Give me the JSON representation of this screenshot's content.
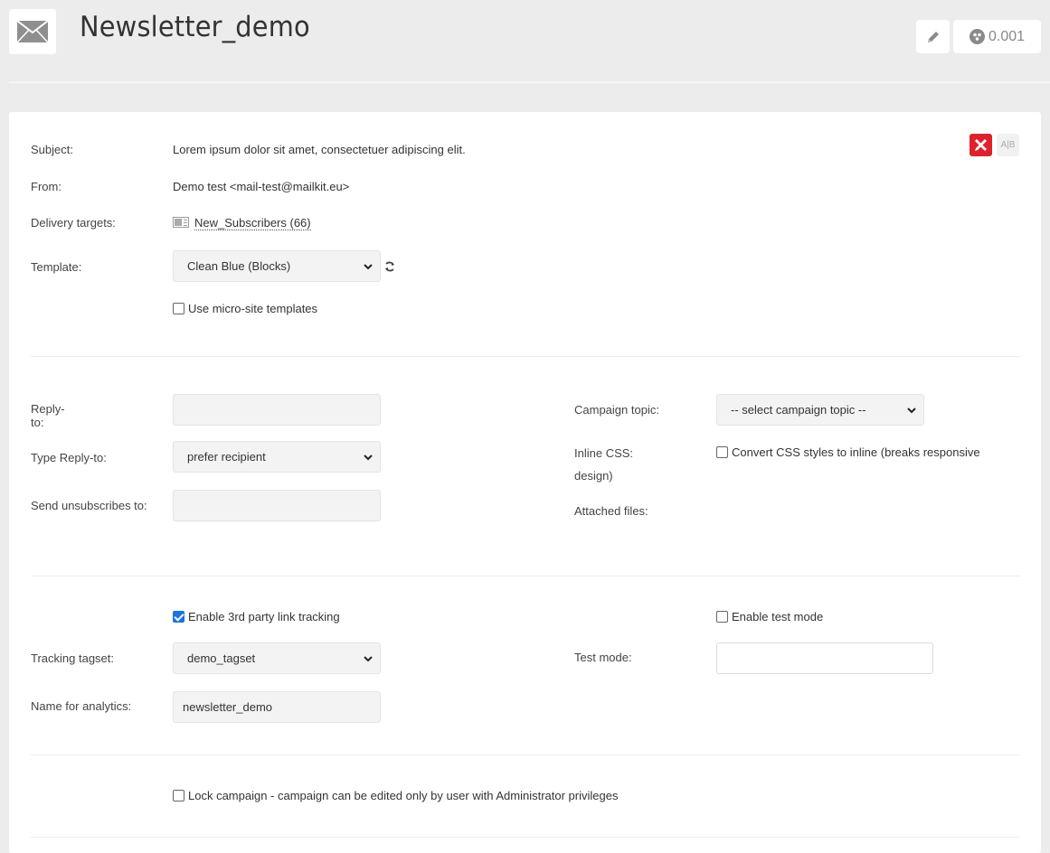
{
  "header": {
    "title": "Newsletter_demo",
    "icon": "envelope-icon",
    "edit_icon": "pencil-icon",
    "score_icon": "spam-score-icon",
    "score_value": "0.001"
  },
  "toolbar": {
    "tools_icon": "tools-icon",
    "ab_label": "A|B",
    "accent_color": "#e0202a"
  },
  "general": {
    "subject_label": "Subject:",
    "subject_value": "Lorem ipsum dolor sit amet, consectetuer adipiscing elit.",
    "from_label": "From:",
    "from_value": "Demo test <mail-test@mailkit.eu>",
    "targets_label": "Delivery targets:",
    "targets_value": "New_Subscribers (66)",
    "template_label": "Template:",
    "template_value": "Clean Blue (Blocks)",
    "microsite_label": "Use micro-site templates",
    "microsite_checked": false
  },
  "reply": {
    "reply_to_label": "Reply-to:",
    "reply_to_value": "",
    "type_reply_label": "Type Reply-to:",
    "type_reply_value": "prefer recipient",
    "unsub_label": "Send unsubscribes to:",
    "unsub_value": "",
    "topic_label": "Campaign topic:",
    "topic_value": "-- select campaign topic --",
    "inline_css_label_1": "Inline CSS:",
    "inline_css_label_2": "design)",
    "inline_css_option": "Convert CSS styles to inline (breaks responsive",
    "inline_css_checked": false,
    "attached_label": "Attached files:"
  },
  "tracking": {
    "third_party_label": "Enable 3rd party link tracking",
    "third_party_checked": true,
    "tagset_label": "Tracking tagset:",
    "tagset_value": "demo_tagset",
    "analytics_label": "Name for analytics:",
    "analytics_value": "newsletter_demo",
    "test_mode_enable_label": "Enable test mode",
    "test_mode_checked": false,
    "test_mode_label": "Test mode:",
    "test_mode_value": ""
  },
  "lock": {
    "label": "Lock campaign - campaign can be edited only by user with Administrator privileges",
    "checked": false
  }
}
